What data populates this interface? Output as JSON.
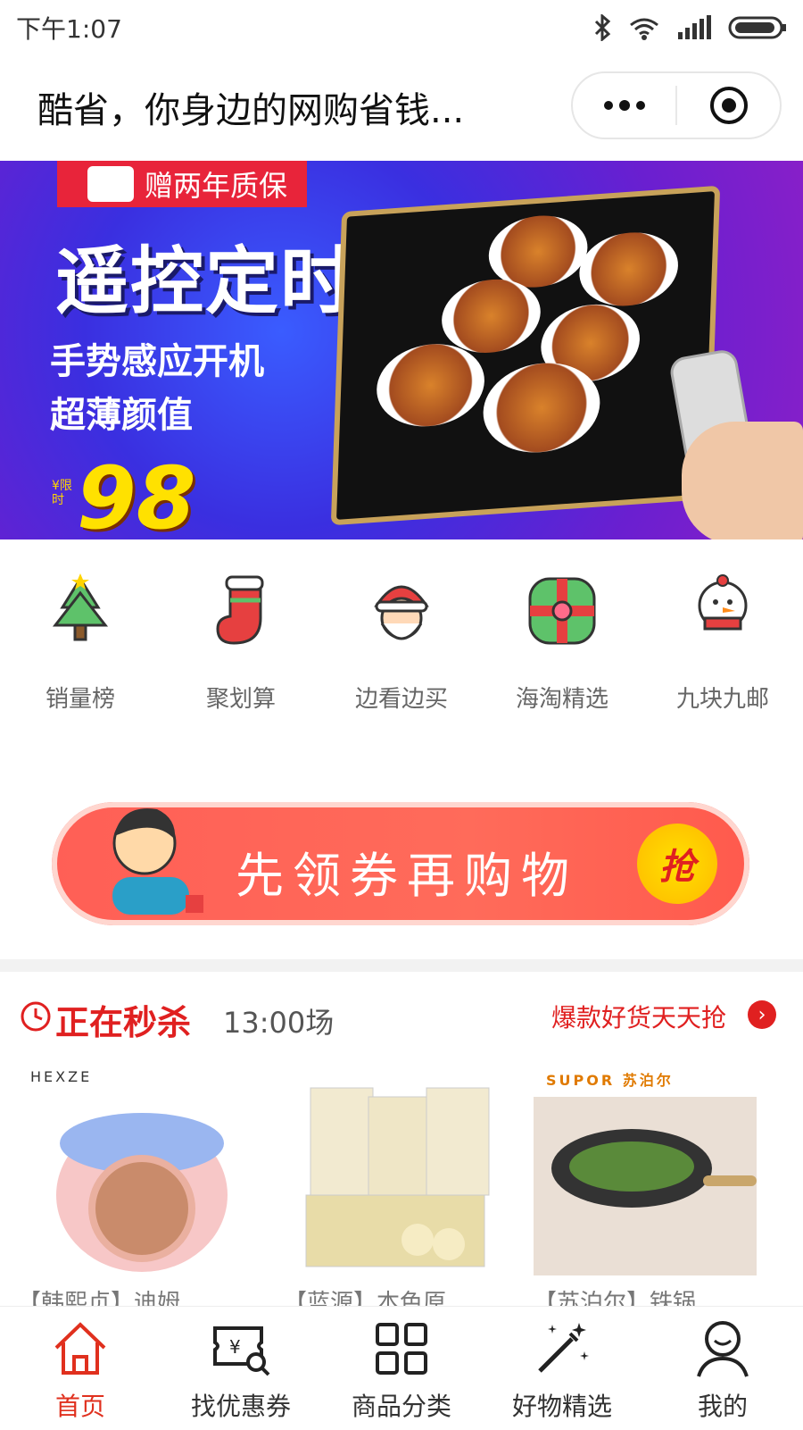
{
  "status_bar": {
    "time": "下午1:07"
  },
  "header": {
    "title": "酷省，你身边的网购省钱..."
  },
  "banner": {
    "tag": "赠两年质保",
    "headline": "遥控定时",
    "line1": "手势感应开机",
    "line2": "超薄颜值",
    "price_side": "¥限时",
    "price": "98"
  },
  "categories": [
    {
      "label": "销量榜",
      "icon": "christmas-tree-icon"
    },
    {
      "label": "聚划算",
      "icon": "stocking-icon"
    },
    {
      "label": "边看边买",
      "icon": "santa-icon"
    },
    {
      "label": "海淘精选",
      "icon": "gift-box-icon"
    },
    {
      "label": "九块九邮",
      "icon": "snowman-icon"
    }
  ],
  "coupon_banner": {
    "text": "先领券再购物",
    "button": "抢"
  },
  "flash_sale": {
    "title": "正在秒杀",
    "time": "13:00场",
    "more": "爆款好货天天抢"
  },
  "goods": [
    {
      "brand": "HEXZE",
      "name": "【韩熙贞】迪姆"
    },
    {
      "brand": "",
      "name": "【蓝源】本色原"
    },
    {
      "brand": "SUPOR 苏泊尔",
      "name": "【苏泊尔】铁锅"
    }
  ],
  "tabbar": [
    {
      "label": "首页",
      "icon": "home-icon",
      "active": true
    },
    {
      "label": "找优惠券",
      "icon": "coupon-search-icon",
      "active": false
    },
    {
      "label": "商品分类",
      "icon": "grid-icon",
      "active": false
    },
    {
      "label": "好物精选",
      "icon": "magic-wand-icon",
      "active": false
    },
    {
      "label": "我的",
      "icon": "user-icon",
      "active": false
    }
  ],
  "colors": {
    "accent": "#e0301e",
    "banner_bg": "#3a2fe0",
    "coupon_bg": "#ff5f56"
  }
}
